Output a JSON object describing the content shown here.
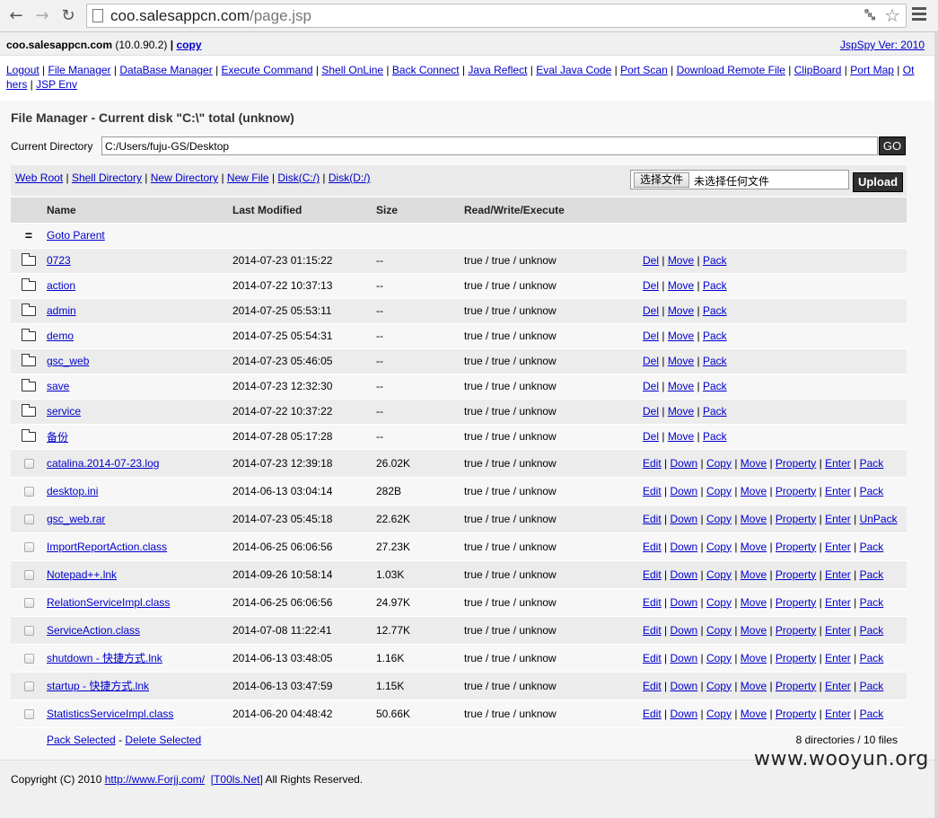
{
  "browser": {
    "url_host": "coo.salesappcn.com",
    "url_path": "/page.jsp",
    "back_icon": "arrow-left-icon",
    "forward_icon": "arrow-right-icon",
    "reload_icon": "reload-icon",
    "translate_icon": "translate-icon",
    "star_icon": "star-icon",
    "menu_icon": "hamburger-menu-icon"
  },
  "header": {
    "host": "coo.salesappcn.com",
    "ip": "(10.0.90.2)",
    "pipe": "|",
    "copy": "copy",
    "version": "JspSpy Ver: 2010"
  },
  "nav": [
    "Logout",
    "File Manager",
    "DataBase Manager",
    "Execute Command",
    "Shell OnLine",
    "Back Connect",
    "Java Reflect",
    "Eval Java Code",
    "Port Scan",
    "Download Remote File",
    "ClipBoard",
    "Port Map",
    "Others",
    "JSP Env"
  ],
  "nav_others_part1": "Ot",
  "nav_others_part2": "hers",
  "file_manager": {
    "title": "File Manager - Current disk \"C:\\\" total (unknow)",
    "current_dir_label": "Current Directory",
    "current_dir_value": "C:/Users/fuju-GS/Desktop",
    "go_label": "GO",
    "quick_links": [
      "Web Root",
      "Shell Directory",
      "New Directory",
      "New File",
      "Disk(C:/)",
      "Disk(D:/)"
    ],
    "choose_file_label": "选择文件",
    "no_file_label": "未选择任何文件",
    "upload_label": "Upload"
  },
  "table": {
    "headers": [
      "Name",
      "Last Modified",
      "Size",
      "Read/Write/Execute"
    ],
    "parent_symbol": "=",
    "parent_label": "Goto Parent",
    "dir_ops": [
      "Del",
      "Move",
      "Pack"
    ],
    "directories": [
      {
        "name": "0723",
        "modified": "2014-07-23 01:15:22",
        "size": "--",
        "rwx": "true / true / unknow"
      },
      {
        "name": "action",
        "modified": "2014-07-22 10:37:13",
        "size": "--",
        "rwx": "true / true / unknow"
      },
      {
        "name": "admin",
        "modified": "2014-07-25 05:53:11",
        "size": "--",
        "rwx": "true / true / unknow"
      },
      {
        "name": "demo",
        "modified": "2014-07-25 05:54:31",
        "size": "--",
        "rwx": "true / true / unknow"
      },
      {
        "name": "gsc_web",
        "modified": "2014-07-23 05:46:05",
        "size": "--",
        "rwx": "true / true / unknow"
      },
      {
        "name": "save",
        "modified": "2014-07-23 12:32:30",
        "size": "--",
        "rwx": "true / true / unknow"
      },
      {
        "name": "service",
        "modified": "2014-07-22 10:37:22",
        "size": "--",
        "rwx": "true / true / unknow"
      },
      {
        "name": "备份",
        "modified": "2014-07-28 05:17:28",
        "size": "--",
        "rwx": "true / true / unknow"
      }
    ],
    "files": [
      {
        "name": "catalina.2014-07-23.log",
        "modified": "2014-07-23 12:39:18",
        "size": "26.02K",
        "rwx": "true / true / unknow",
        "ops": [
          "Edit",
          "Down",
          "Copy",
          "Move",
          "Property",
          "Enter",
          "Pack"
        ]
      },
      {
        "name": "desktop.ini",
        "modified": "2014-06-13 03:04:14",
        "size": "282B",
        "rwx": "true / true / unknow",
        "ops": [
          "Edit",
          "Down",
          "Copy",
          "Move",
          "Property",
          "Enter",
          "Pack"
        ]
      },
      {
        "name": "gsc_web.rar",
        "modified": "2014-07-23 05:45:18",
        "size": "22.62K",
        "rwx": "true / true / unknow",
        "ops": [
          "Edit",
          "Down",
          "Copy",
          "Move",
          "Property",
          "Enter",
          "UnPack"
        ]
      },
      {
        "name": "ImportReportAction.class",
        "modified": "2014-06-25 06:06:56",
        "size": "27.23K",
        "rwx": "true / true / unknow",
        "ops": [
          "Edit",
          "Down",
          "Copy",
          "Move",
          "Property",
          "Enter",
          "Pack"
        ]
      },
      {
        "name": "Notepad++.lnk",
        "modified": "2014-09-26 10:58:14",
        "size": "1.03K",
        "rwx": "true / true / unknow",
        "ops": [
          "Edit",
          "Down",
          "Copy",
          "Move",
          "Property",
          "Enter",
          "Pack"
        ]
      },
      {
        "name": "RelationServiceImpl.class",
        "modified": "2014-06-25 06:06:56",
        "size": "24.97K",
        "rwx": "true / true / unknow",
        "ops": [
          "Edit",
          "Down",
          "Copy",
          "Move",
          "Property",
          "Enter",
          "Pack"
        ]
      },
      {
        "name": "ServiceAction.class",
        "modified": "2014-07-08 11:22:41",
        "size": "12.77K",
        "rwx": "true / true / unknow",
        "ops": [
          "Edit",
          "Down",
          "Copy",
          "Move",
          "Property",
          "Enter",
          "Pack"
        ]
      },
      {
        "name": "shutdown - 快捷方式.lnk",
        "modified": "2014-06-13 03:48:05",
        "size": "1.16K",
        "rwx": "true / true / unknow",
        "ops": [
          "Edit",
          "Down",
          "Copy",
          "Move",
          "Property",
          "Enter",
          "Pack"
        ]
      },
      {
        "name": "startup - 快捷方式.lnk",
        "modified": "2014-06-13 03:47:59",
        "size": "1.15K",
        "rwx": "true / true / unknow",
        "ops": [
          "Edit",
          "Down",
          "Copy",
          "Move",
          "Property",
          "Enter",
          "Pack"
        ]
      },
      {
        "name": "StatisticsServiceImpl.class",
        "modified": "2014-06-20 04:48:42",
        "size": "50.66K",
        "rwx": "true / true / unknow",
        "ops": [
          "Edit",
          "Down",
          "Copy",
          "Move",
          "Property",
          "Enter",
          "Pack"
        ]
      }
    ],
    "pack_selected": "Pack Selected",
    "dash": "-",
    "delete_selected": "Delete Selected",
    "summary": "8 directories / 10 files"
  },
  "footer": {
    "copyright_prefix": "Copyright (C) 2010",
    "link1": "http://www.Forjj.com/",
    "link2": "[T00ls.Net]",
    "suffix": "All Rights Reserved."
  },
  "watermark": "www.wooyun.org",
  "icons": {
    "directory": "folder-icon",
    "file": "checkbox"
  }
}
